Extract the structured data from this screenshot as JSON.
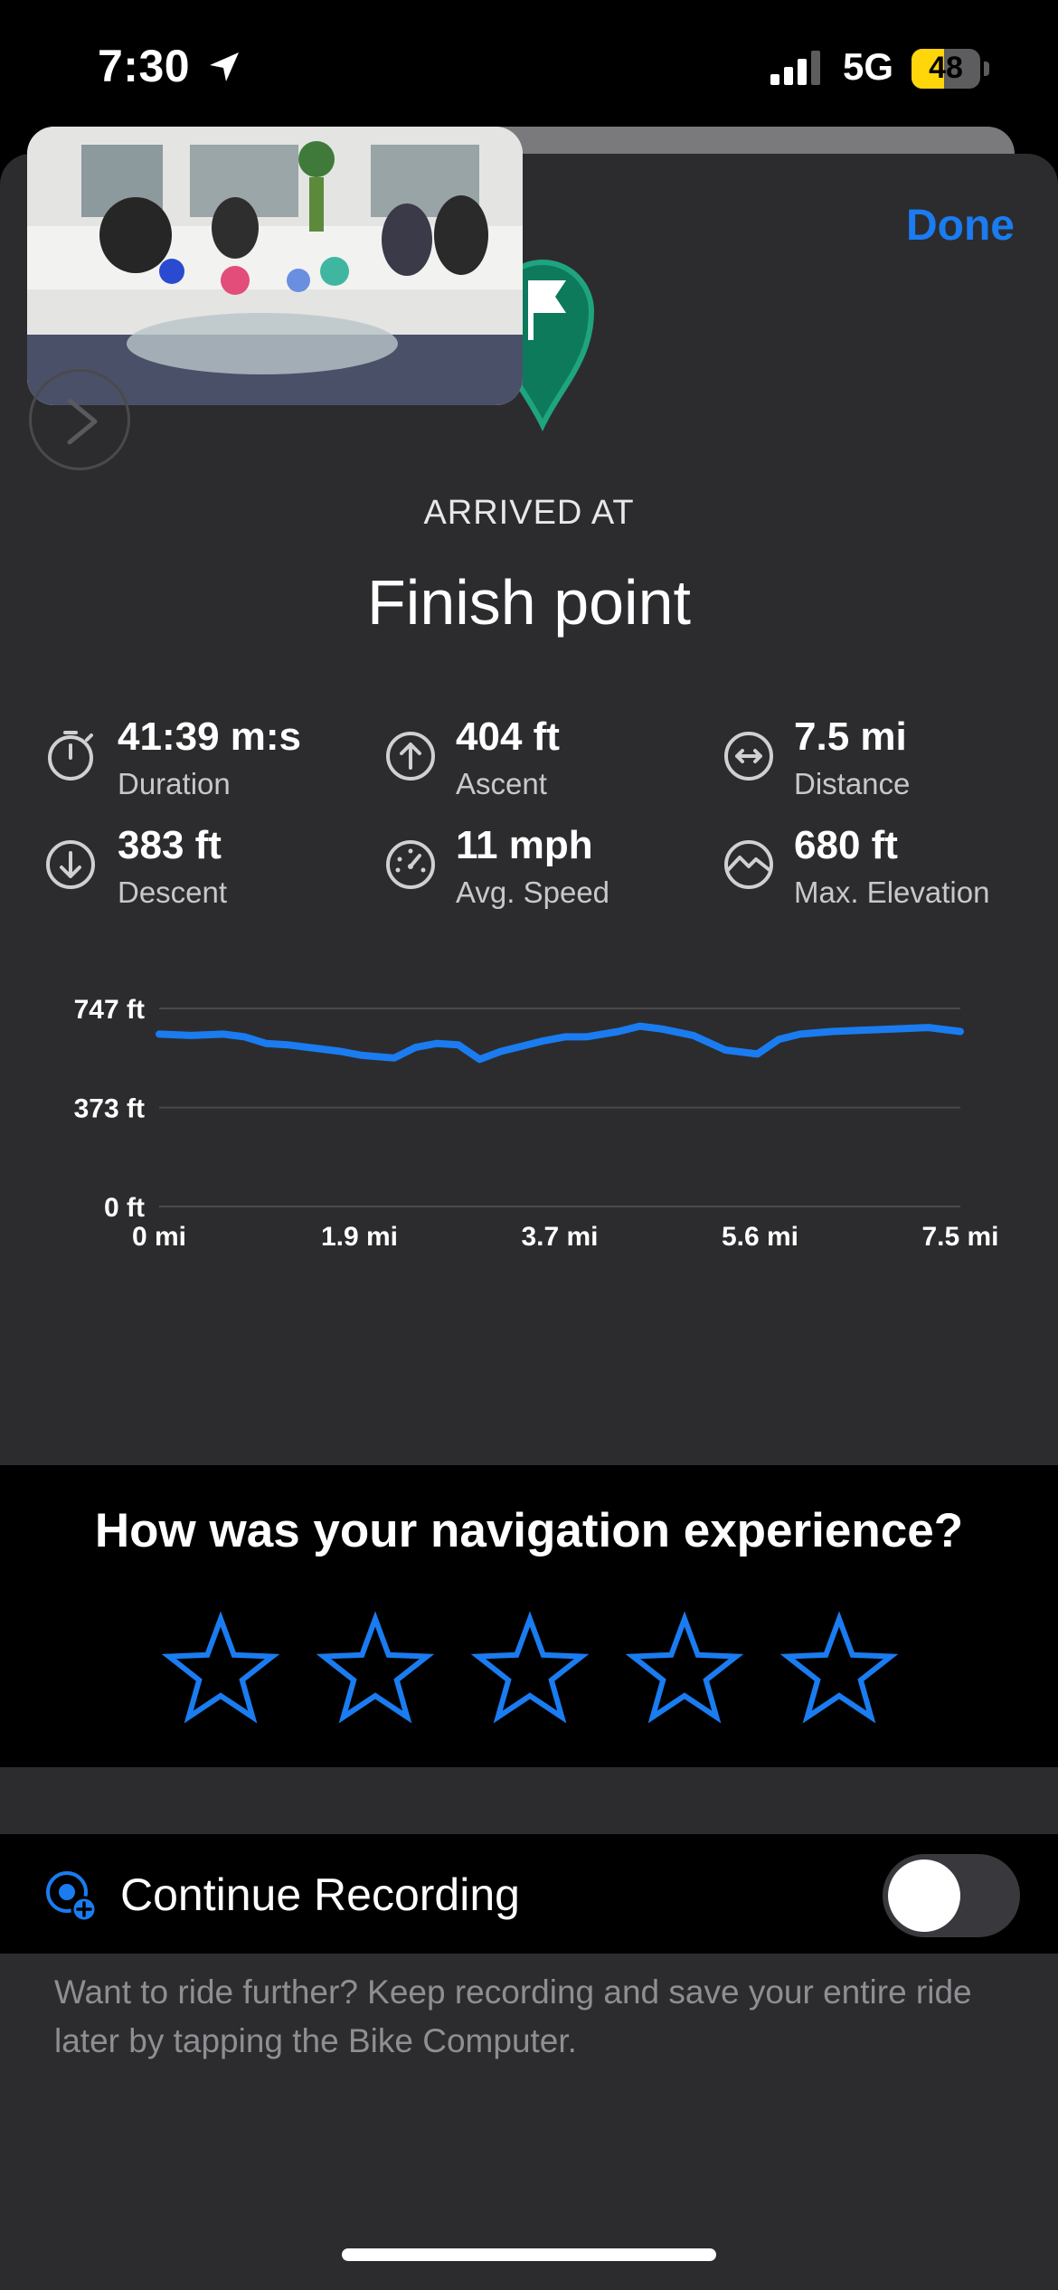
{
  "status_bar": {
    "time": "7:30",
    "network": "5G",
    "battery": "48"
  },
  "header": {
    "done_label": "Done"
  },
  "arrival": {
    "caption": "ARRIVED AT",
    "place": "Finish point"
  },
  "stats": [
    {
      "value": "41:39 m:s",
      "label": "Duration",
      "icon": "stopwatch-icon"
    },
    {
      "value": "404 ft",
      "label": "Ascent",
      "icon": "arrow-up-circle-icon"
    },
    {
      "value": "7.5 mi",
      "label": "Distance",
      "icon": "arrows-left-right-circle-icon"
    },
    {
      "value": "383 ft",
      "label": "Descent",
      "icon": "arrow-down-circle-icon"
    },
    {
      "value": "11 mph",
      "label": "Avg. Speed",
      "icon": "speedometer-icon"
    },
    {
      "value": "680 ft",
      "label": "Max. Elevation",
      "icon": "mountain-circle-icon"
    }
  ],
  "chart_data": {
    "type": "line",
    "y_tick_labels": [
      "747 ft",
      "373 ft",
      "0 ft"
    ],
    "x_tick_labels": [
      "0 mi",
      "1.9 mi",
      "3.7 mi",
      "5.6 mi",
      "7.5 mi"
    ],
    "xlim": [
      0,
      7.5
    ],
    "ylim": [
      0,
      747
    ],
    "grid": true,
    "series_color": "#1a7cf0",
    "x": [
      0,
      0.3,
      0.6,
      0.8,
      1.0,
      1.2,
      1.4,
      1.7,
      1.9,
      2.2,
      2.4,
      2.6,
      2.8,
      3.0,
      3.2,
      3.4,
      3.6,
      3.8,
      4.0,
      4.3,
      4.5,
      4.7,
      5.0,
      5.3,
      5.6,
      5.8,
      6.0,
      6.3,
      6.6,
      6.9,
      7.2,
      7.5
    ],
    "y": [
      650,
      645,
      650,
      640,
      615,
      610,
      600,
      585,
      570,
      560,
      600,
      615,
      610,
      555,
      585,
      605,
      625,
      640,
      640,
      660,
      680,
      670,
      645,
      590,
      575,
      630,
      650,
      660,
      665,
      670,
      675,
      660
    ]
  },
  "rating": {
    "question": "How was your navigation experience?",
    "star_count": 5,
    "accent": "#1a7cf0"
  },
  "continue_recording": {
    "label": "Continue Recording",
    "enabled": false,
    "note": "Want to ride further? Keep recording and save your entire ride later by tapping the Bike Computer."
  }
}
